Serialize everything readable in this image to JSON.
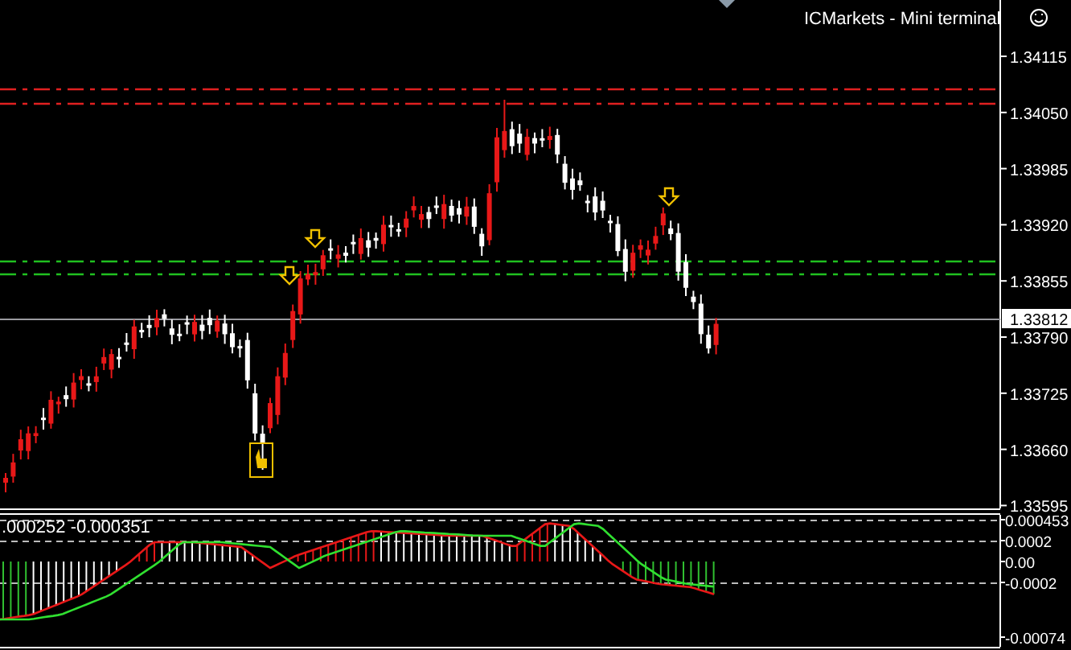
{
  "window": {
    "title": "ICMarkets - Mini terminal"
  },
  "price_axis": {
    "labels": [
      "1.34115",
      "1.34050",
      "1.33985",
      "1.33920",
      "1.33855",
      "1.33790",
      "1.33725",
      "1.33660",
      "1.33595"
    ],
    "current_price": "1.33812"
  },
  "indicator": {
    "values_text": ".000252 -0.000351",
    "axis_labels": [
      "0.000453",
      "0.0002",
      "0.00",
      "-0.0002",
      "-0.00074"
    ]
  }
}
